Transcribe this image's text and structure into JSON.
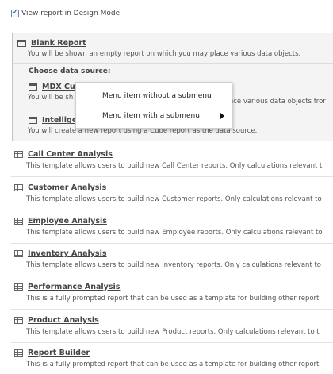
{
  "design_mode": {
    "label": "View report in Design Mode",
    "checked": true
  },
  "blank_report": {
    "title": "Blank Report",
    "description": "You will be shown an empty report on which you may place various data objects."
  },
  "data_source": {
    "label": "Choose data source:",
    "mdx": {
      "title": "MDX Cu",
      "description_left": "You will be sh",
      "description_right": "ace various data objects fror"
    },
    "intelligent": {
      "title": "Intellige",
      "description": "You will create a new report using a Cube report as the data source."
    }
  },
  "context_menu": {
    "item1": "Menu item without a submenu",
    "item2": "Menu item with a submenu"
  },
  "templates": [
    {
      "title": "Call Center Analysis",
      "description": "This template allows users to build new Call Center reports. Only calculations relevant t"
    },
    {
      "title": "Customer Analysis",
      "description": "This template allows users to build new Customer reports. Only calculations relevant to"
    },
    {
      "title": "Employee Analysis",
      "description": "This template allows users to build new Employee reports. Only calculations relevant to"
    },
    {
      "title": "Inventory Analysis",
      "description": "This template allows users to build new Inventory reports. Only calculations relevant to"
    },
    {
      "title": "Performance Analysis",
      "description": "This is a fully prompted report that can be used as a template for building other report"
    },
    {
      "title": "Product Analysis",
      "description": "This template allows users to build new Product reports. Only calculations relevant to t"
    },
    {
      "title": "Report Builder",
      "description": "This is a fully prompted report that can be used as a template for building other report"
    }
  ]
}
